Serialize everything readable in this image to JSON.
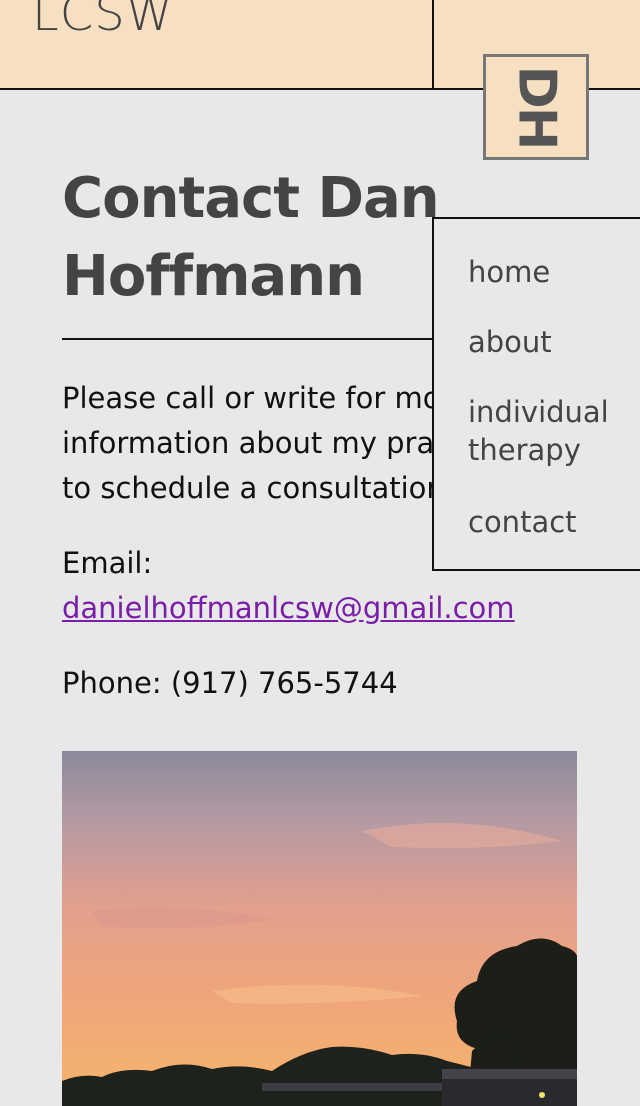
{
  "header": {
    "title": "LCSW",
    "logo_text": "DH"
  },
  "nav": {
    "items": [
      {
        "label": "home"
      },
      {
        "label": "about"
      },
      {
        "label": "individual therapy"
      },
      {
        "label": "contact"
      }
    ]
  },
  "main": {
    "title": "Contact Dan Hoffmann",
    "intro": "Please call or write for more information about my practice or to schedule a consultation.",
    "email_label": "Email:",
    "email": "danielhoffmanlcsw@gmail.com",
    "phone": "Phone: (917) 765-5744"
  },
  "colors": {
    "header_bg": "#f7e0c2",
    "page_bg": "#e8e8e8",
    "link": "#7a1da8"
  }
}
